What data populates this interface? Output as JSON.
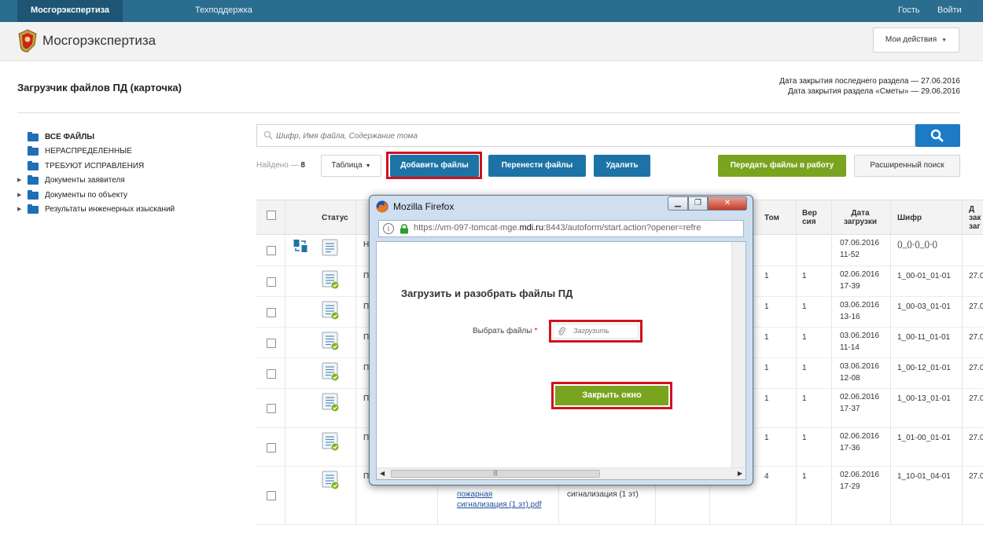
{
  "topnav": {
    "main": "Мосгорэкспертиза",
    "support": "Техподдержка",
    "guest": "Гость",
    "login": "Войти"
  },
  "header": {
    "logo_text": "Мосгорэкспертиза",
    "my_actions": "Мои действия"
  },
  "page": {
    "title": "Загрузчик файлов ПД (карточка)",
    "deadline_last": "Дата закрытия последнего раздела — 27.06.2016",
    "deadline_estimates": "Дата закрытия раздела «Сметы» — 29.06.2016"
  },
  "tree": [
    {
      "label": "ВСЕ ФАЙЛЫ",
      "expandable": false,
      "bold": true
    },
    {
      "label": "НЕРАСПРЕДЕЛЕННЫЕ",
      "expandable": false,
      "bold": false
    },
    {
      "label": "ТРЕБУЮТ ИСПРАВЛЕНИЯ",
      "expandable": false,
      "bold": false
    },
    {
      "label": "Документы заявителя",
      "expandable": true,
      "bold": false
    },
    {
      "label": "Документы по объекту",
      "expandable": true,
      "bold": false
    },
    {
      "label": "Результаты инженерных изысканий",
      "expandable": true,
      "bold": false
    }
  ],
  "search": {
    "placeholder": "Шифр, Имя файла, Содержание тома"
  },
  "toolbar": {
    "found_label": "Найдено —",
    "found_count": "8",
    "table_label": "Таблица",
    "add_files": "Добавить файлы",
    "move_files": "Перенести файлы",
    "delete": "Удалить",
    "transfer": "Передать файлы в работу",
    "advanced_search": "Расширенный поиск"
  },
  "table": {
    "headers": {
      "status": "Статус",
      "tom": "Том",
      "version": "Вер сия",
      "date": "Дата загрузки",
      "cipher": "Шифр",
      "last": "Д зак заг"
    },
    "rows": [
      {
        "type": "Н",
        "tom": "",
        "version": "",
        "date": "07.06.2016",
        "time": "11-52",
        "cipher": "()_()-()_()-()",
        "last": "",
        "swap": true
      },
      {
        "type": "П",
        "tom": "1",
        "version": "1",
        "date": "02.06.2016",
        "time": "17-39",
        "cipher": "1_00-01_01-01",
        "last": "27.0",
        "swap": false
      },
      {
        "type": "П",
        "tom": "1",
        "version": "1",
        "date": "03.06.2016",
        "time": "13-16",
        "cipher": "1_00-03_01-01",
        "last": "27.0",
        "swap": false
      },
      {
        "type": "П",
        "tom": "1",
        "version": "1",
        "date": "03.06.2016",
        "time": "11-14",
        "cipher": "1_00-11_01-01",
        "last": "27.0",
        "swap": false
      },
      {
        "type": "П",
        "tom": "1",
        "version": "1",
        "date": "03.06.2016",
        "time": "12-08",
        "cipher": "1_00-12_01-01",
        "last": "27.0",
        "swap": false
      },
      {
        "type": "П",
        "tom": "1",
        "version": "1",
        "date": "02.06.2016",
        "time": "17-37",
        "cipher": "1_00-13_01-01",
        "last": "27.0",
        "swap": false
      },
      {
        "type": "П",
        "tom": "1",
        "version": "1",
        "date": "02.06.2016",
        "time": "17-36",
        "cipher": "1_01-00_01-01",
        "last": "27.0",
        "swap": false
      },
      {
        "type": "П",
        "tom": "4",
        "version": "1",
        "date": "02.06.2016",
        "time": "17-29",
        "cipher": "1_10-01_04-01",
        "last": "27.0",
        "swap": false
      }
    ],
    "last_row_file": "пожарная сигнализация (1 эт).pdf",
    "last_row_content": "сигнализация (1 эт)"
  },
  "firefox": {
    "title": "Mozilla Firefox",
    "url_prefix": "https://vm-097-tomcat-mge.",
    "url_domain": "mdi.ru",
    "url_suffix": ":8443/autoform/start.action?opener=refre",
    "form_title": "Загрузить и разобрать файлы ПД",
    "choose_label": "Выбрать файлы",
    "upload_label": "Загрузить",
    "close_button": "Закрыть окно"
  },
  "colors": {
    "nav": "#2b6d8f",
    "primary": "#1d73a6",
    "green": "#79a41f",
    "highlight": "#d0121e"
  }
}
